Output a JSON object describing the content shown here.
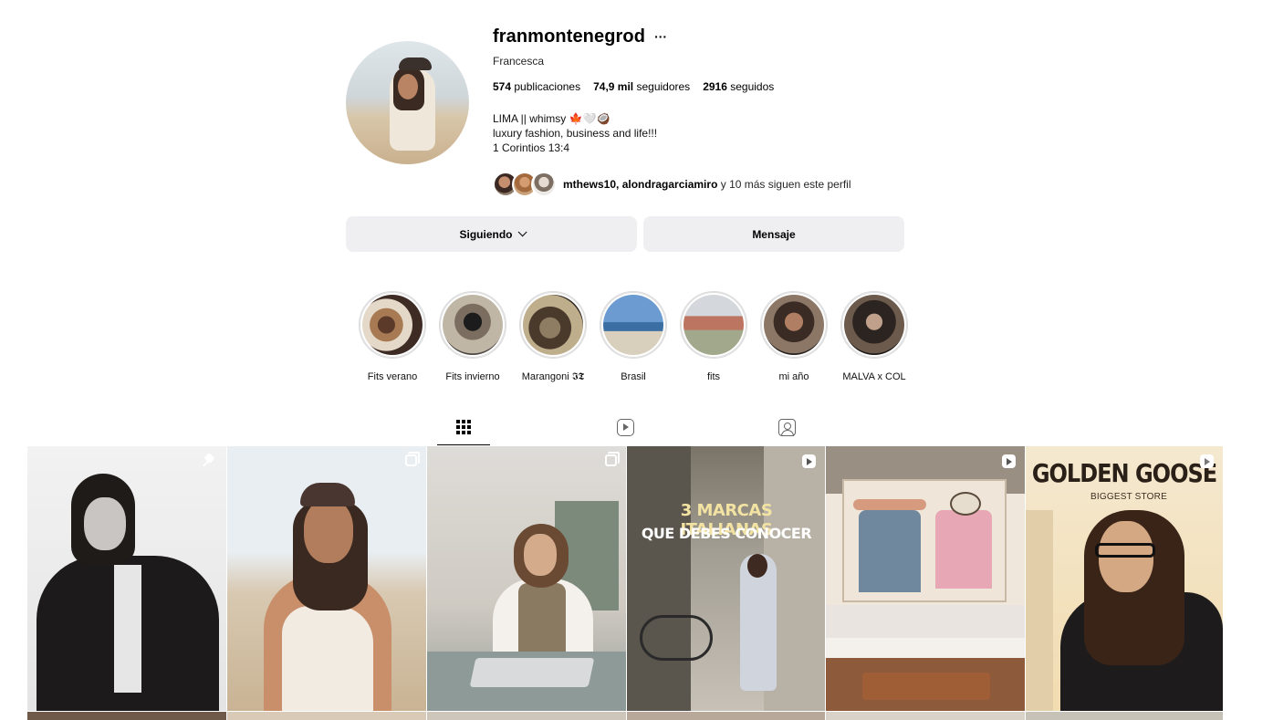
{
  "profile": {
    "username": "franmontenegrod",
    "more_label": "···",
    "full_name": "Francesca",
    "stats": {
      "posts_count": "574",
      "posts_label": "publicaciones",
      "followers_count": "74,9 mil",
      "followers_label": "seguidores",
      "following_count": "2916",
      "following_label": "seguidos"
    },
    "bio": {
      "line1": "LIMA || whimsy 🍁🤍🥥",
      "line2": "luxury fashion, business and life!!!",
      "line3": "1 Corintios 13:4"
    },
    "followed_by": {
      "names": "mthews10, alondragarciamiro",
      "suffix": "y 10 más siguen este perfil"
    }
  },
  "actions": {
    "follow_label": "Siguiendo",
    "message_label": "Mensaje"
  },
  "highlights": [
    {
      "label": "Fits verano"
    },
    {
      "label": "Fits invierno"
    },
    {
      "label": "Marangoni 𝕴𝕿"
    },
    {
      "label": "Brasil"
    },
    {
      "label": "fits"
    },
    {
      "label": "mi año"
    },
    {
      "label": "MALVA x COL"
    }
  ],
  "tabs": {
    "posts_icon": "grid-icon",
    "reels_icon": "reels-icon",
    "tagged_icon": "tagged-icon"
  },
  "posts": [
    {
      "badge": "pin-icon"
    },
    {
      "badge": "carousel-icon"
    },
    {
      "badge": "carousel-icon"
    },
    {
      "badge": "reel-icon",
      "overlay_line1": "3 MARCAS ITALIANAS",
      "overlay_line2": "QUE DEBES CONOCER"
    },
    {
      "badge": "reel-icon"
    },
    {
      "badge": "reel-icon",
      "overlay_title": "GOLDEN GOOSE",
      "overlay_subtitle": "BIGGEST STORE"
    }
  ],
  "colors": {
    "button_bg": "#efeff1",
    "text": "#000000"
  }
}
